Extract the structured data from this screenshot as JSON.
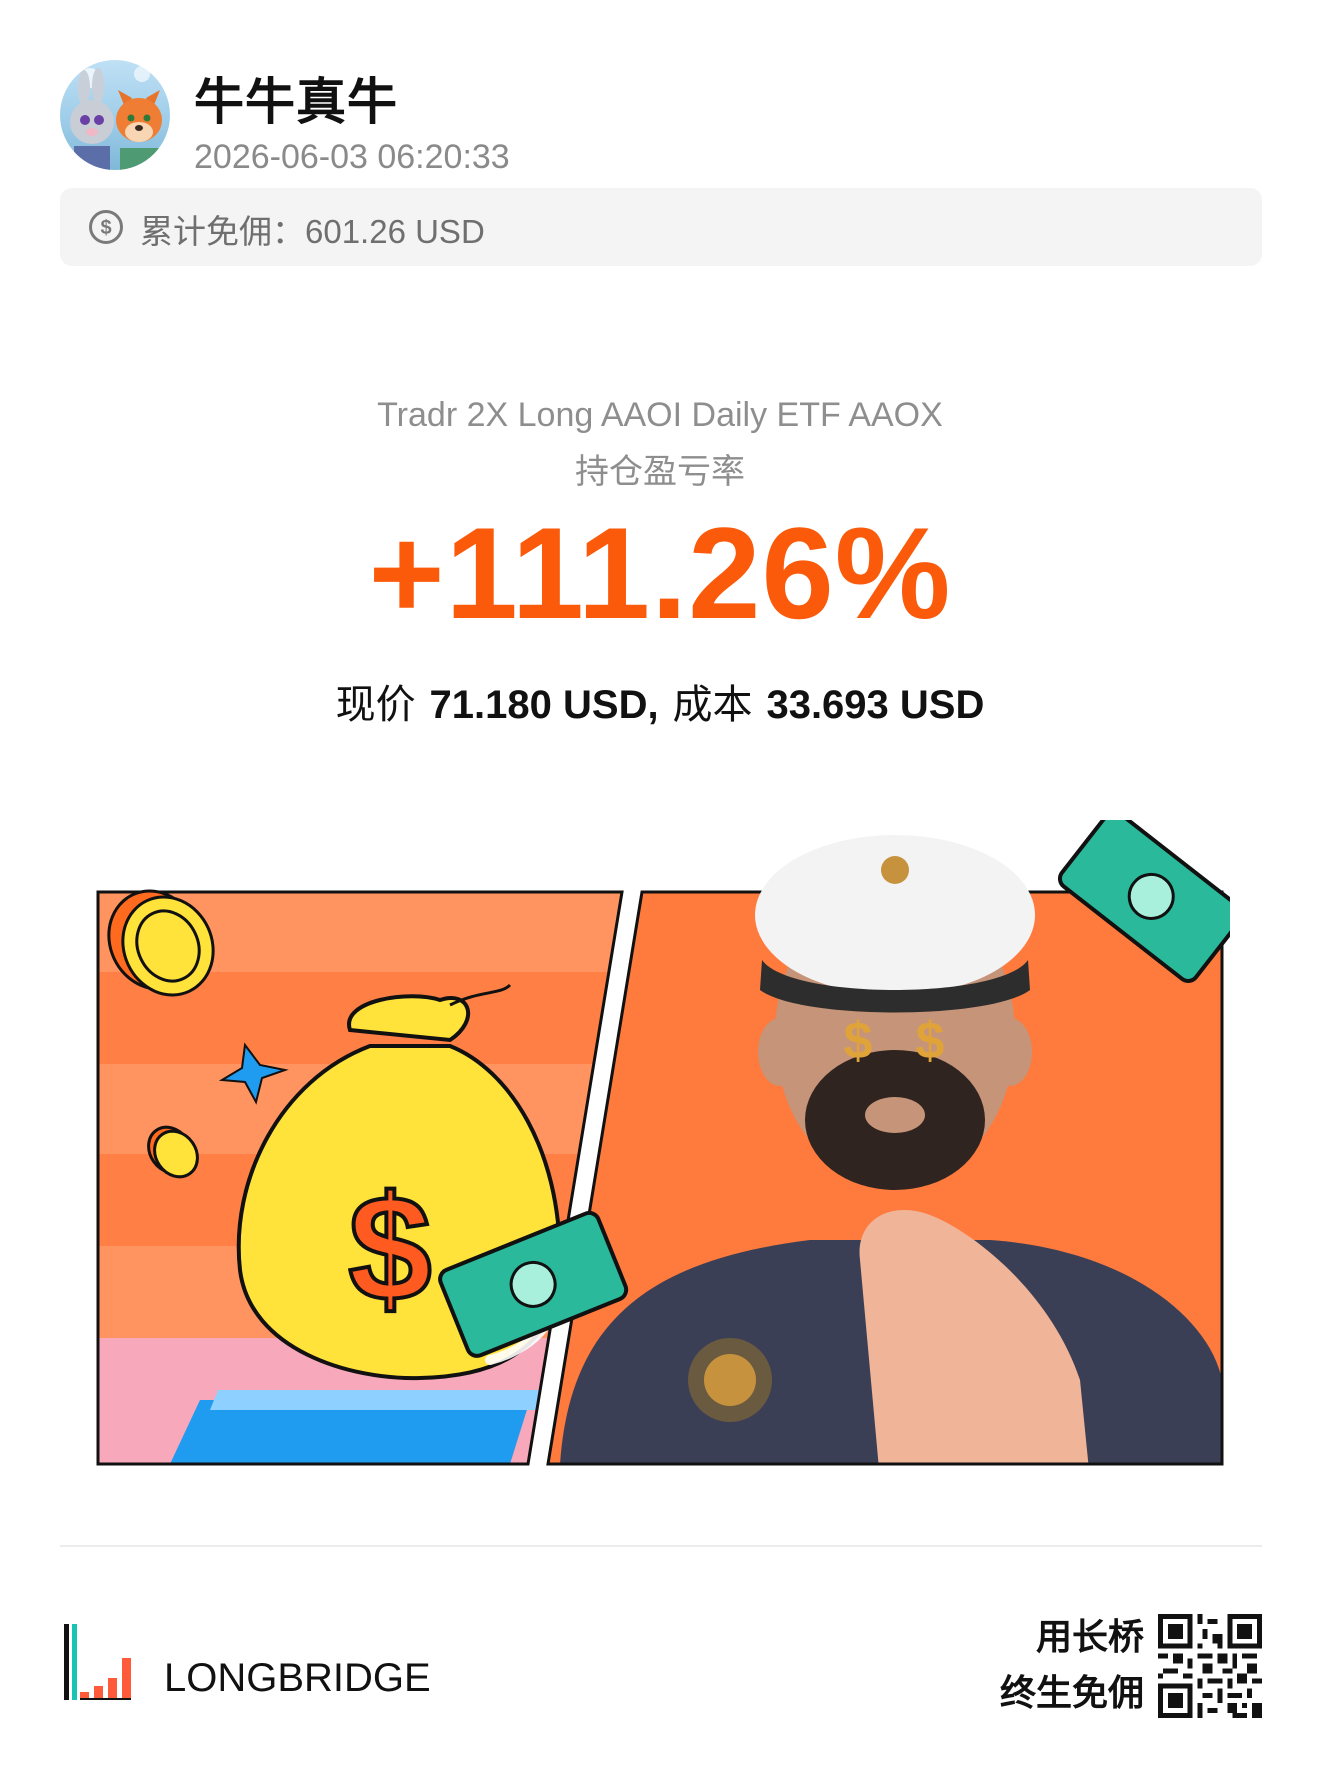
{
  "header": {
    "username": "牛牛真牛",
    "timestamp": "2026-06-03 06:20:33",
    "avatar_icon": "avatar-cartoon-fox-rabbit"
  },
  "commission": {
    "label": "累计免佣：",
    "value": "601.26 USD",
    "icon": "dollar-circle-icon"
  },
  "position": {
    "product_name": "Tradr 2X Long AAOI Daily ETF AAOX",
    "metric_label": "持仓盈亏率",
    "pnl_rate": "+111.26%",
    "current_label": "现价",
    "current_value": "71.180 USD,",
    "cost_label": "成本",
    "cost_value": "33.693 USD"
  },
  "colors": {
    "accent": "#fa5a0a",
    "bg_orange": "#ff7f45",
    "money_green": "#2ab99a",
    "bag_yellow": "#ffe23a"
  },
  "footer": {
    "brand_name": "LONGBRIDGE",
    "slogan_line1": "用长桥",
    "slogan_line2": "终生免佣"
  }
}
